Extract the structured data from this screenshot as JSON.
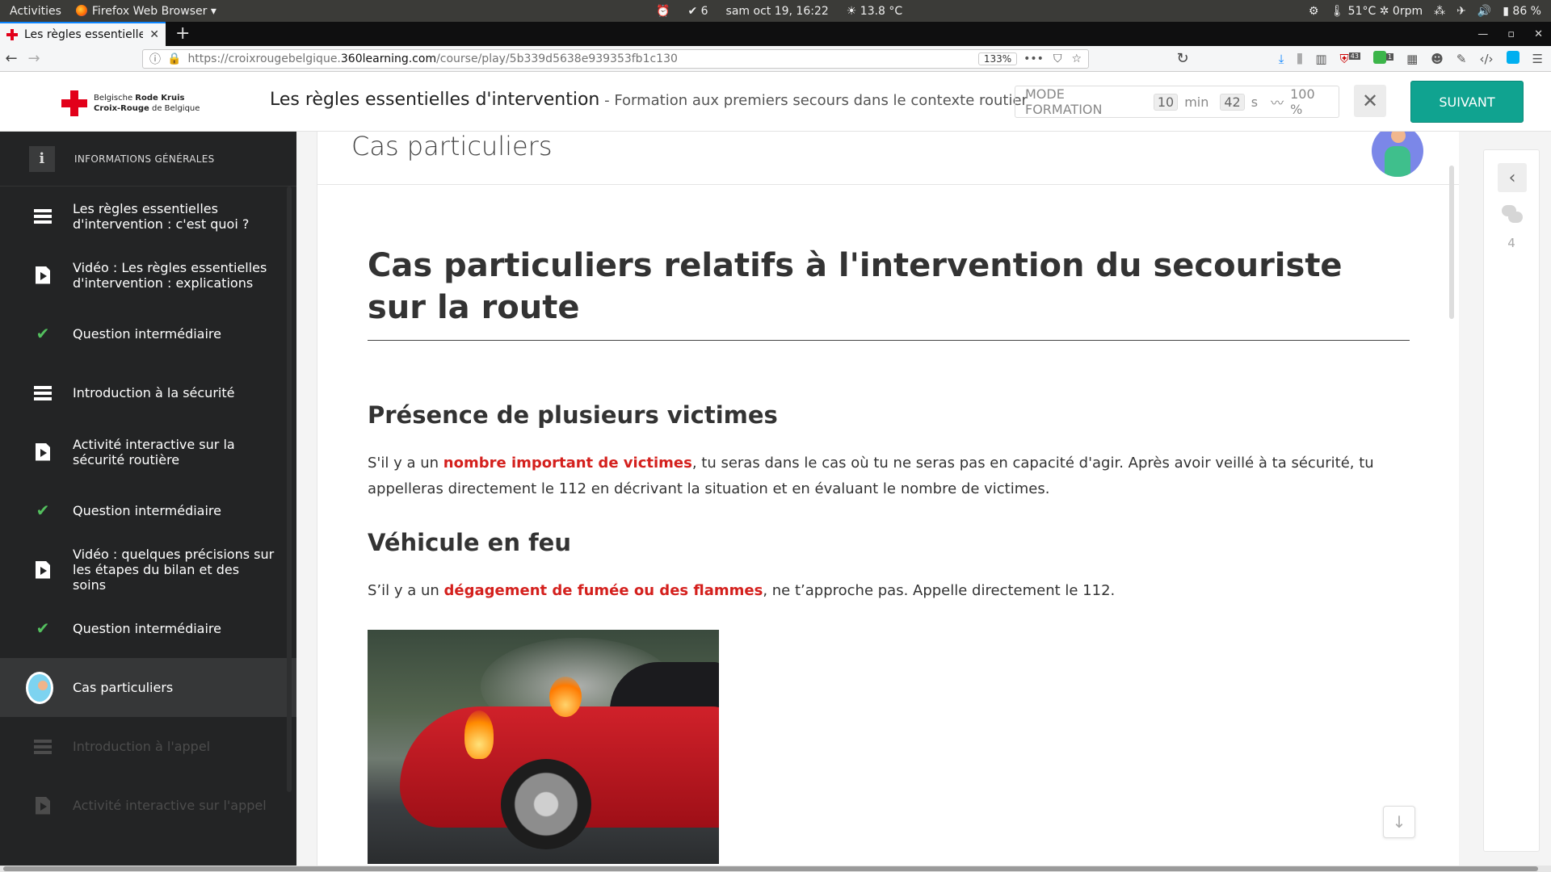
{
  "system_bar": {
    "activities": "Activities",
    "app": "Firefox Web Browser",
    "alarm_count": "6",
    "datetime": "sam oct 19, 16:22",
    "weather": "13.8 °C",
    "cpu_temp": "51°C",
    "fan": "0rpm",
    "battery": "86 %"
  },
  "browser": {
    "tab_title": "Les règles essentielles d",
    "url_prefix": "https://croixrougebelgique.",
    "url_domain": "360learning.com",
    "url_path": "/course/play/5b339d5638e939353fb1c130",
    "zoom": "133%",
    "badge_43": "43",
    "badge_1": "1"
  },
  "header": {
    "logo_line1_a": "Belgische ",
    "logo_line1_b": "Rode Kruis",
    "logo_line2_a": "Croix-Rouge",
    "logo_line2_b": " de Belgique",
    "title": "Les règles essentielles d'intervention",
    "subtitle": " - Formation aux premiers secours dans le contexte routier",
    "mode_label": "MODE FORMATION",
    "minutes": "10",
    "min_unit": "min",
    "seconds": "42",
    "sec_unit": "s",
    "progress": "100 %",
    "next_label": "SUIVANT"
  },
  "sidebar": {
    "info_label": "INFORMATIONS GÉNÉRALES",
    "items": [
      {
        "label": "Les règles essentielles d'intervention : c'est quoi ?",
        "icon": "text-icon",
        "state": "done"
      },
      {
        "label": "Vidéo : Les règles essentielles d'intervention : explications",
        "icon": "video-icon",
        "state": "done"
      },
      {
        "label": "Question intermédiaire",
        "icon": "check-icon",
        "state": "done"
      },
      {
        "label": "Introduction à la sécurité",
        "icon": "text-icon",
        "state": "done"
      },
      {
        "label": "Activité interactive sur la sécurité routière",
        "icon": "video-icon",
        "state": "done"
      },
      {
        "label": "Question intermédiaire",
        "icon": "check-icon",
        "state": "done"
      },
      {
        "label": "Vidéo : quelques précisions sur les étapes du bilan et des soins",
        "icon": "video-icon",
        "state": "done"
      },
      {
        "label": "Question intermédiaire",
        "icon": "check-icon",
        "state": "done"
      },
      {
        "label": "Cas particuliers",
        "icon": "avatar-icon",
        "state": "active"
      },
      {
        "label": "Introduction à l'appel",
        "icon": "text-icon",
        "state": "locked"
      },
      {
        "label": "Activité interactive sur l'appel",
        "icon": "video-icon",
        "state": "locked"
      }
    ]
  },
  "content": {
    "section_title": "Cas particuliers",
    "h1": "Cas particuliers relatifs à l'intervention du secouriste sur la route",
    "s1_title": "Présence de plusieurs victimes",
    "s1_p_a": "S'il y a un ",
    "s1_p_em": "nombre important de victimes",
    "s1_p_b": ", tu seras dans le cas où tu ne seras pas en capacité d'agir. Après avoir veillé à ta sécurité, tu appelleras directement le 112 en décrivant la situation et en évaluant le nombre de victimes.",
    "s2_title": "Véhicule en feu",
    "s2_p_a": "S’il y a un ",
    "s2_p_em": "dégagement de fumée ou des flammes",
    "s2_p_b": ", ne t’approche pas. Appelle directement le 112."
  },
  "rail": {
    "comment_count": "4"
  }
}
